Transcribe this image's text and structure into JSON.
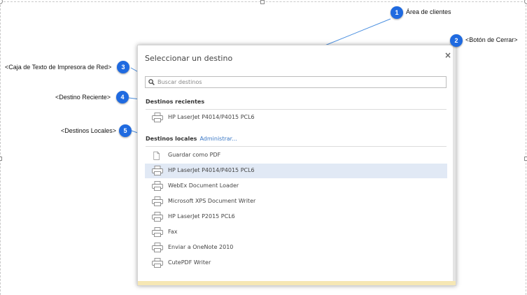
{
  "dialog": {
    "title": "Seleccionar un destino",
    "close_symbol": "×",
    "search_placeholder": "Buscar destinos",
    "recent_heading": "Destinos recientes",
    "recent_items": [
      {
        "label": "HP LaserJet P4014/P4015 PCL6",
        "icon": "printer-icon"
      }
    ],
    "local_heading": "Destinos locales",
    "manage_link": "Administrar...",
    "local_items": [
      {
        "label": "Guardar como PDF",
        "icon": "document-icon"
      },
      {
        "label": "HP LaserJet P4014/P4015 PCL6",
        "icon": "printer-icon",
        "selected": true
      },
      {
        "label": "WebEx Document Loader",
        "icon": "printer-icon"
      },
      {
        "label": "Microsoft XPS Document Writer",
        "icon": "printer-icon"
      },
      {
        "label": "HP LaserJet P2015 PCL6",
        "icon": "printer-icon"
      },
      {
        "label": "Fax",
        "icon": "printer-icon"
      },
      {
        "label": "Enviar a OneNote 2010",
        "icon": "printer-icon"
      },
      {
        "label": "CutePDF Writer",
        "icon": "printer-icon"
      }
    ]
  },
  "callouts": [
    {
      "number": "1",
      "label": "Área de clientes"
    },
    {
      "number": "2",
      "label": "<Botón de Cerrar>"
    },
    {
      "number": "3",
      "label": "<Caja de Texto de Impresora de Red>"
    },
    {
      "number": "4",
      "label": "<Destino Reciente>"
    },
    {
      "number": "5",
      "label": "<Destinos Locales>"
    }
  ],
  "colors": {
    "callout_badge": "#1f6ae0",
    "callout_line": "#4a8fe0",
    "selected_row": "#e1e9f5",
    "link": "#3b78c6"
  }
}
